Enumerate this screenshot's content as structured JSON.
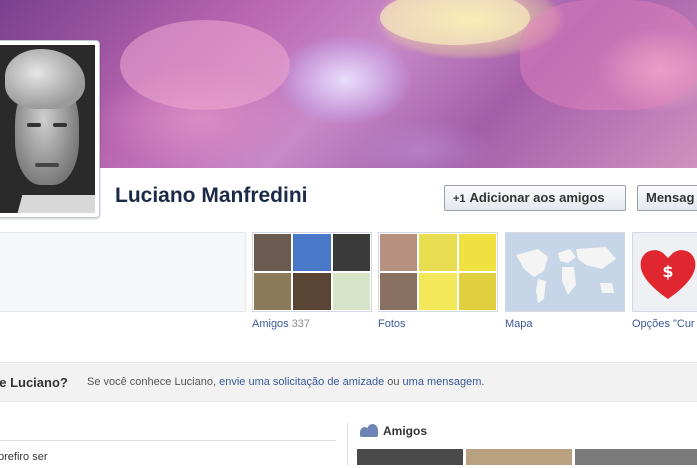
{
  "profile": {
    "name": "Luciano Manfredini"
  },
  "actions": {
    "add_friend_icon": "+1",
    "add_friend_label": "Adicionar aos amigos",
    "message_label": "Mensag"
  },
  "tiles": {
    "friends_label": "Amigos",
    "friends_count": "337",
    "photos_label": "Fotos",
    "map_label": "Mapa",
    "apps_label": "Opções \"Cur"
  },
  "know_bar": {
    "question": "ce Luciano?",
    "text_prefix": "Se você conhece Luciano, ",
    "friend_request_link": "envie uma solicitação de amizade",
    "text_mid": " ou ",
    "message_link": "uma mensagem",
    "text_suffix": "."
  },
  "left_column": {
    "prefer_text": "prefiro ser"
  },
  "friends_section": {
    "title": "Amigos"
  },
  "colors": {
    "link": "#3b5998",
    "name": "#1c2a47"
  },
  "icons": {
    "friends_section": "friends-group-icon"
  }
}
